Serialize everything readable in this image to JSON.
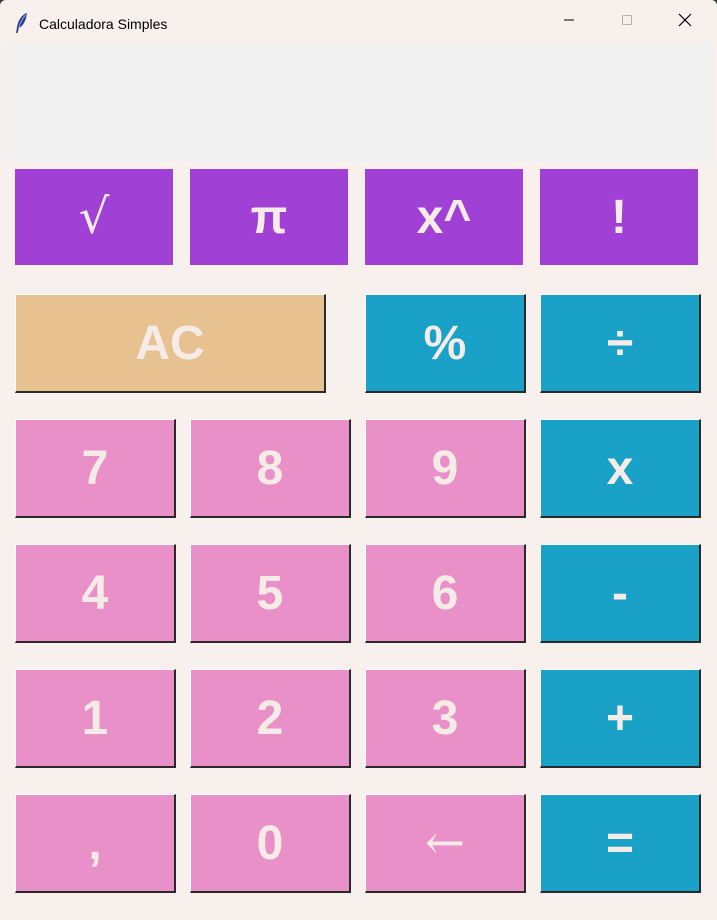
{
  "window": {
    "title": "Calculadora Simples",
    "icon": "feather-icon",
    "controls": [
      "minimize-icon",
      "maximize-icon",
      "close-icon"
    ]
  },
  "display": {
    "value": ""
  },
  "buttons": {
    "sqrt": "√",
    "pi": "π",
    "power": "x^",
    "factorial": "!",
    "clear": "AC",
    "percent": "%",
    "divide": "÷",
    "seven": "7",
    "eight": "8",
    "nine": "9",
    "multiply": "x",
    "four": "4",
    "five": "5",
    "six": "6",
    "minus": "-",
    "one": "1",
    "two": "2",
    "three": "3",
    "plus": "+",
    "comma": ",",
    "zero": "0",
    "backspace": "←",
    "equals": "="
  },
  "colors": {
    "scientific": "#a040d4",
    "clear": "#e8c190",
    "operator": "#19a1c7",
    "digit": "#e990c8",
    "label": "#f6ece7",
    "background": "#f8f0ec",
    "display": "#f1f0f0"
  }
}
